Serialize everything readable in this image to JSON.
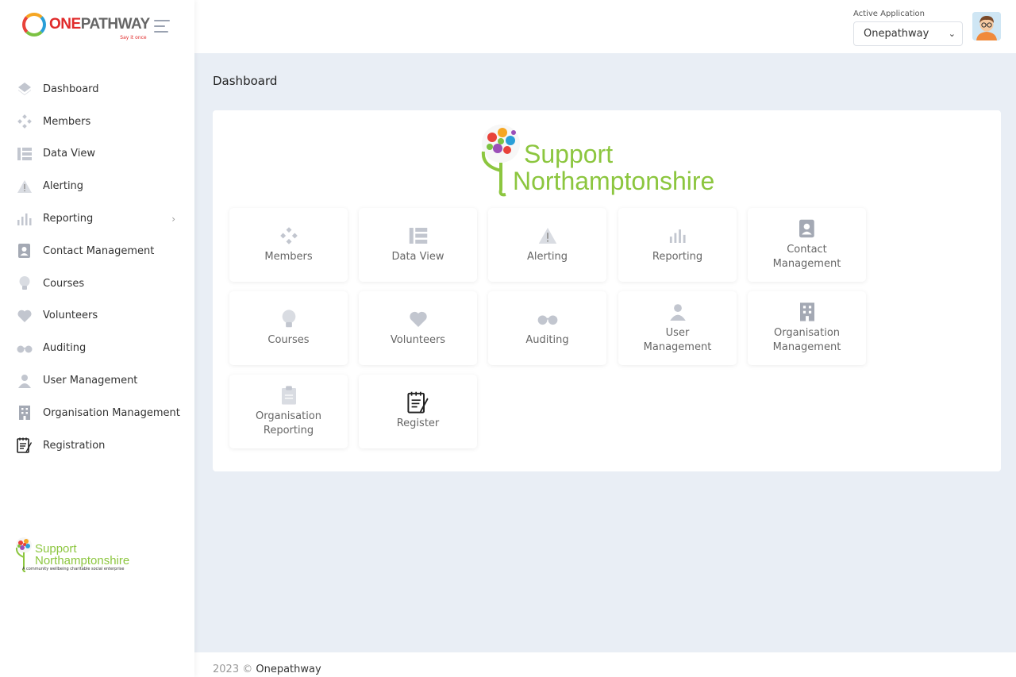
{
  "brand": {
    "name_part1": "ONE",
    "name_part2": "PATHWAY",
    "tagline": "Say it once"
  },
  "sidebar": {
    "items": [
      {
        "label": "Dashboard",
        "icon": "diamond-icon"
      },
      {
        "label": "Members",
        "icon": "members-icon"
      },
      {
        "label": "Data View",
        "icon": "list-icon"
      },
      {
        "label": "Alerting",
        "icon": "warning-icon"
      },
      {
        "label": "Reporting",
        "icon": "bar-chart-icon"
      },
      {
        "label": "Contact Management",
        "icon": "contact-book-icon"
      },
      {
        "label": "Courses",
        "icon": "lightbulb-icon"
      },
      {
        "label": "Volunteers",
        "icon": "heart-icon"
      },
      {
        "label": "Auditing",
        "icon": "glasses-icon"
      },
      {
        "label": "User Management",
        "icon": "user-icon"
      },
      {
        "label": "Organisation Management",
        "icon": "building-icon"
      },
      {
        "label": "Registration",
        "icon": "notepad-icon"
      }
    ],
    "footer_logo": {
      "name_line1": "Support",
      "name_line2": "Northamptonshire",
      "tagline": "A community wellbeing charitable social enterprise"
    }
  },
  "header": {
    "active_app_label": "Active Application",
    "active_app_value": "Onepathway"
  },
  "main": {
    "page_title": "Dashboard",
    "hero_logo": {
      "line1": "Support",
      "line2": "Northamptonshire"
    },
    "tiles": [
      {
        "label": "Members",
        "icon": "members-icon"
      },
      {
        "label": "Data View",
        "icon": "list-icon"
      },
      {
        "label": "Alerting",
        "icon": "warning-icon"
      },
      {
        "label": "Reporting",
        "icon": "bar-chart-icon"
      },
      {
        "label": "Contact Management",
        "icon": "contact-book-icon"
      },
      {
        "label": "Courses",
        "icon": "lightbulb-icon"
      },
      {
        "label": "Volunteers",
        "icon": "heart-icon"
      },
      {
        "label": "Auditing",
        "icon": "glasses-icon"
      },
      {
        "label": "User Management",
        "icon": "user-icon"
      },
      {
        "label": "Organisation Management",
        "icon": "building-icon"
      },
      {
        "label": "Organisation Reporting",
        "icon": "clipboard-icon"
      },
      {
        "label": "Register",
        "icon": "notepad-icon"
      }
    ]
  },
  "footer": {
    "year": "2023 ©",
    "brand": "Onepathway"
  },
  "colors": {
    "accent_green": "#8cc63f",
    "brand_red": "#e02b2b",
    "icon_grey": "#c2c6cf",
    "background": "#e9eef5"
  }
}
